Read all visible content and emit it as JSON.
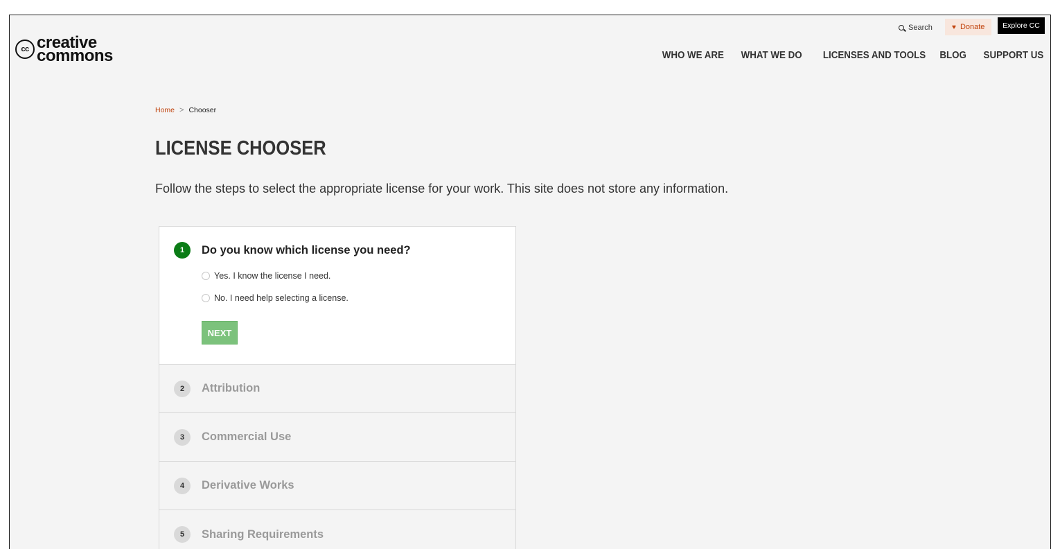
{
  "logo": {
    "cc": "cc",
    "line1": "creative",
    "line2": "commons"
  },
  "utility": {
    "search": "Search",
    "donate": "Donate",
    "explore": "Explore CC"
  },
  "nav": {
    "items": [
      "WHO WE ARE",
      "WHAT WE DO",
      "LICENSES AND TOOLS",
      "BLOG",
      "SUPPORT US"
    ]
  },
  "breadcrumb": {
    "home": "Home",
    "separator": ">",
    "current": "Chooser"
  },
  "page": {
    "title": "LICENSE CHOOSER",
    "intro": "Follow the steps to select the appropriate license for your work. This site does not store any information."
  },
  "stepper": {
    "active": {
      "number": "1",
      "title": "Do you know which license you need?",
      "options": [
        "Yes. I know the license I need.",
        "No. I need help selecting a license."
      ],
      "next_label": "NEXT"
    },
    "steps": [
      {
        "number": "2",
        "title": "Attribution"
      },
      {
        "number": "3",
        "title": "Commercial Use"
      },
      {
        "number": "4",
        "title": "Derivative Works"
      },
      {
        "number": "5",
        "title": "Sharing Requirements"
      }
    ]
  },
  "colors": {
    "accent_green": "#0b7c16",
    "next_button": "#7cc27c",
    "link_orange": "#c1440e",
    "background": "#f4f4f4"
  }
}
